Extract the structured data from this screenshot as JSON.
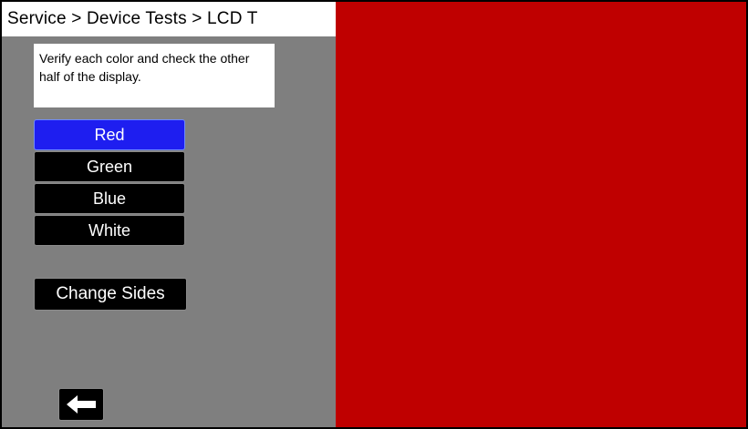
{
  "header": {
    "breadcrumb": "Service > Device Tests > LCD T"
  },
  "instructions": {
    "text": "Verify each color and check the other half of the display."
  },
  "color_buttons": [
    {
      "label": "Red",
      "selected": true
    },
    {
      "label": "Green",
      "selected": false
    },
    {
      "label": "Blue",
      "selected": false
    },
    {
      "label": "White",
      "selected": false
    }
  ],
  "change_sides": {
    "label": "Change Sides"
  },
  "back_button": {
    "icon": "arrow-left-icon"
  },
  "test_area": {
    "current_color": "#bf0000"
  },
  "colors": {
    "panel_bg": "#7f7f7f",
    "selected_button": "#1e1ef0",
    "button_bg": "#000000",
    "test_red": "#bf0000"
  }
}
